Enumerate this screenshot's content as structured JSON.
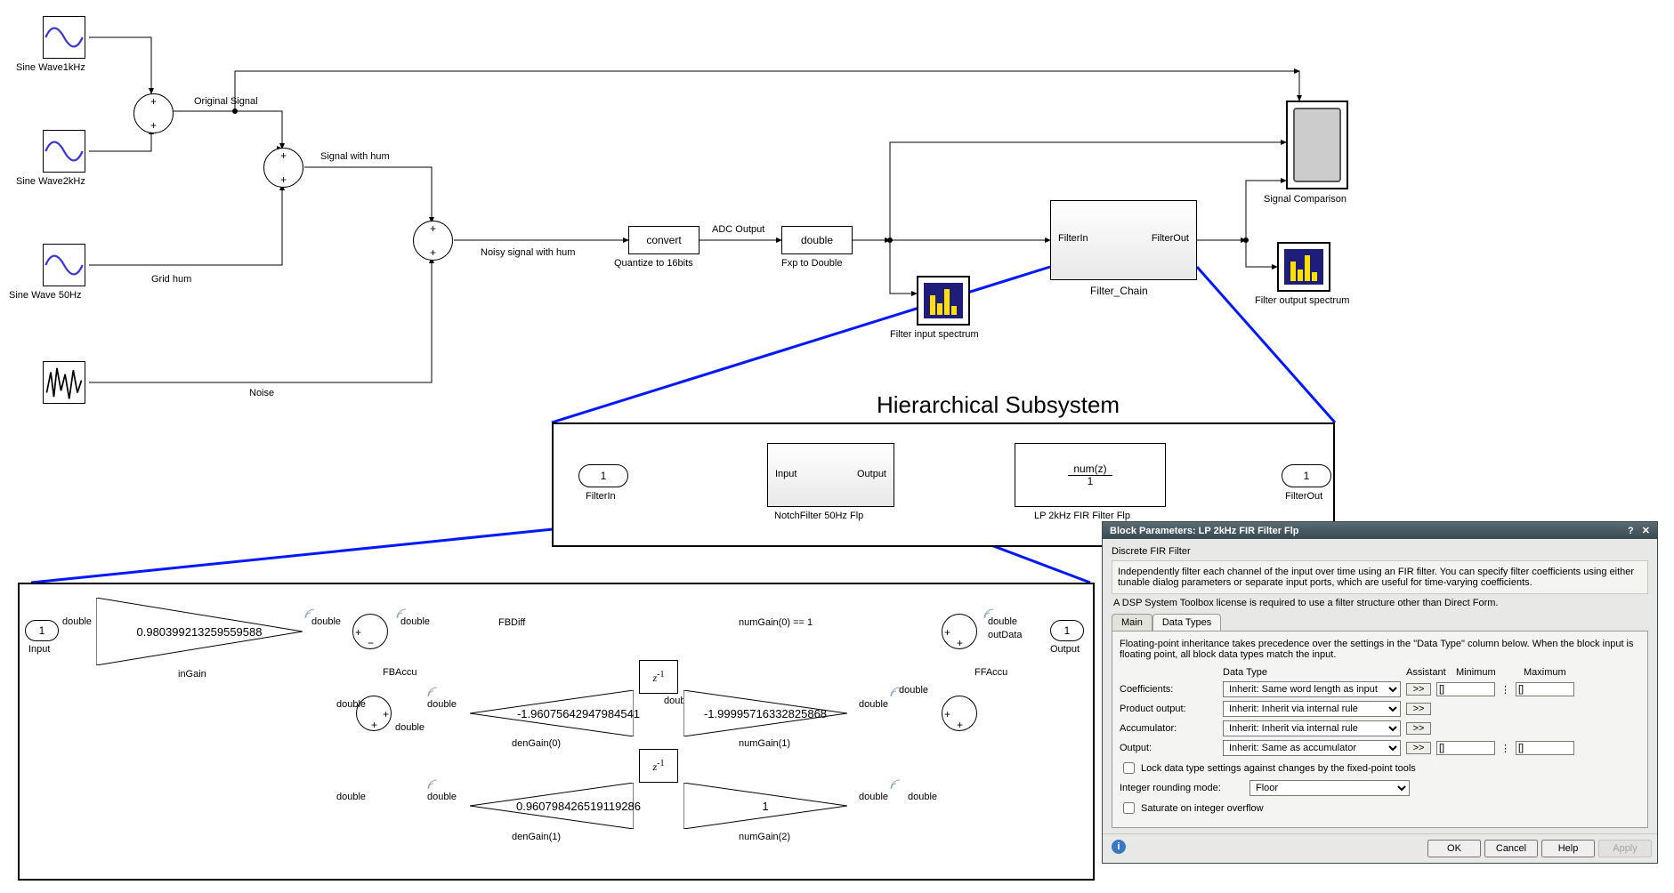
{
  "top": {
    "blocks": {
      "sine1k": "Sine Wave1kHz",
      "sine2k": "Sine Wave2kHz",
      "sine50": "Sine Wave 50Hz",
      "noise": "Noise",
      "gridhum": "Grid hum",
      "origsig": "Original Signal",
      "sigwithhum": "Signal with hum",
      "noisysig": "Noisy signal with hum",
      "convert": "convert",
      "convert_lbl": "Quantize to 16bits",
      "adc_out": "ADC Output",
      "double": "double",
      "double_lbl": "Fxp to Double",
      "fis": "Filter input spectrum",
      "filter_chain": "Filter_Chain",
      "filter_in": "FilterIn",
      "filter_out": "FilterOut",
      "sigcomp": "Signal Comparison",
      "fos": "Filter output spectrum"
    },
    "subsystem_title": "Hierarchical Subsystem",
    "sub": {
      "filterin_port": "1",
      "filterin_lbl": "FilterIn",
      "notch_in": "Input",
      "notch_out": "Output",
      "notch_lbl": "NotchFilter 50Hz Flp",
      "fir_tf": "num(z)",
      "fir_den": "1",
      "fir_lbl": "LP 2kHz FIR Filter Flp",
      "filterout_port": "1",
      "filterout_lbl": "FilterOut"
    }
  },
  "notch": {
    "in_port": "1",
    "in_lbl": "Input",
    "out_port": "1",
    "out_lbl": "Output",
    "sig_double": "double",
    "inGain_lbl": "inGain",
    "inGain_val": "0.980399213259559588",
    "FBDiff": "FBDiff",
    "FBAccu": "FBAccu",
    "FFAccu": "FFAccu",
    "outData": "outData",
    "numGain0": "numGain(0) == 1",
    "delay": "z",
    "delay_sup": "-1",
    "denGain0_lbl": "denGain(0)",
    "denGain0_val": "-1.96075642947984541",
    "numGain1_lbl": "numGain(1)",
    "numGain1_val": "-1.99995716332825868",
    "denGain1_lbl": "denGain(1)",
    "denGain1_val": "0.960798426519119286",
    "numGain2_lbl": "numGain(2)",
    "numGain2_val": "1"
  },
  "dialog": {
    "title": "Block Parameters: LP 2kHz FIR Filter Flp",
    "heading": "Discrete FIR Filter",
    "desc1": "Independently filter each channel of the input over time using an FIR filter. You can specify filter coefficients using either tunable dialog parameters or separate input ports, which are useful for time-varying coefficients.",
    "desc2": "A DSP System Toolbox license is required to use a filter structure other than Direct Form.",
    "tabs": {
      "main": "Main",
      "datatypes": "Data Types"
    },
    "panel_note": "Floating-point inheritance takes precedence over the settings in the \"Data Type\" column below. When the block input is floating point, all block data types match the input.",
    "headers": {
      "dt": "Data Type",
      "assist": "Assistant",
      "min": "Minimum",
      "max": "Maximum"
    },
    "rows": {
      "coeff": {
        "label": "Coefficients:",
        "value": "Inherit: Same word length as input",
        "min": "[]",
        "max": "[]"
      },
      "prodout": {
        "label": "Product output:",
        "value": "Inherit: Inherit via internal rule"
      },
      "accum": {
        "label": "Accumulator:",
        "value": "Inherit: Inherit via internal rule"
      },
      "output": {
        "label": "Output:",
        "value": "Inherit: Same as accumulator",
        "min": "[]",
        "max": "[]"
      }
    },
    "lock": "Lock data type settings against changes by the fixed-point tools",
    "round_lbl": "Integer rounding mode:",
    "round_val": "Floor",
    "saturate": "Saturate on integer overflow",
    "buttons": {
      "ok": "OK",
      "cancel": "Cancel",
      "help": "Help",
      "apply": "Apply"
    },
    "assist_btn": ">>"
  }
}
